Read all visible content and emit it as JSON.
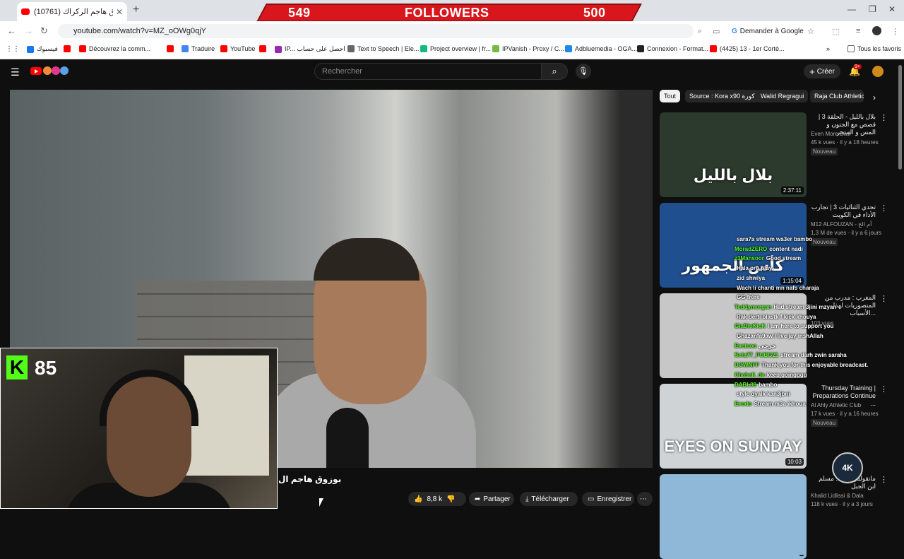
{
  "browser": {
    "tab_title": "بوزوق هاجم الركراك (10761)",
    "url": "youtube.com/watch?v=MZ_oOWg0qjY",
    "ask_google": "Demander à Google",
    "bookmarks": [
      {
        "label": "فيسبوك",
        "color": "#1877f2"
      },
      {
        "label": "",
        "color": "#ff0000"
      },
      {
        "label": "Découvrez la comm...",
        "color": "#ff0000"
      },
      {
        "label": "",
        "color": "#ff0000"
      },
      {
        "label": "Traduire",
        "color": "#4285f4"
      },
      {
        "label": "YouTube",
        "color": "#ff0000"
      },
      {
        "label": "",
        "color": "#ff0000"
      },
      {
        "label": "IP... احصل على حساب",
        "color": "#9c27b0"
      },
      {
        "label": "Text to Speech | Ele...",
        "color": "#666666"
      },
      {
        "label": "Project overview | fr...",
        "color": "#18b87a"
      },
      {
        "label": "IPVanish - Proxy / C...",
        "color": "#70bb44"
      },
      {
        "label": "Adbluemedia - OGA...",
        "color": "#1e88e5"
      },
      {
        "label": "Connexion - Format...",
        "color": "#222222"
      },
      {
        "label": "(4425) 13 - 1er Corté...",
        "color": "#ff0000"
      }
    ],
    "all_favorites": "Tous les favoris"
  },
  "overlay": {
    "left_count": "549",
    "label": "FOLLOWERS",
    "right_count": "500",
    "kick_viewers": "85",
    "quality_badge": "4K"
  },
  "youtube": {
    "search_placeholder": "Rechercher",
    "create_label": "Créer",
    "notif_count": "9+",
    "video_title": "بوزوق هاجم ال",
    "actions": {
      "like_count": "8,8 k",
      "share": "Partager",
      "download": "Télécharger",
      "save": "Enregistrer"
    },
    "chips": [
      "Tout",
      "Source : Kora x90 كورة",
      "Walid Regragui",
      "Raja Club Athletic"
    ],
    "related": [
      {
        "title": "بلال بالليل - الحلقة 3 | قصص مع الجنون و المس و السحر",
        "channel": "Even More Bilal",
        "meta": "45 k vues · il y a 18 heures",
        "badge": "Nouveau",
        "duration": "2:37:11",
        "thumb_color": "#2b3a2c"
      },
      {
        "title": "تحدي الثنائيات 3 | تجارب الأداء في الكويت",
        "channel": "M12 ALFOUZAN - أم الخ",
        "meta": "1,3 M de vues · il y a 6 jours",
        "badge": "Nouveau",
        "duration": "1:15:04",
        "thumb_color": "#1f4f8f"
      },
      {
        "title": "المغرب : مدرب من المنصوريات لهذا الأسباب...",
        "channel": "",
        "meta": "103 vues",
        "badge": "",
        "duration": "",
        "thumb_color": "#c7c7c7"
      },
      {
        "title": "Thursday Training | Preparations Continue ...",
        "channel": "Al Ahly Athletic Club",
        "meta": "17 k vues · il y a 16 heures",
        "badge": "Nouveau",
        "duration": "10:03",
        "thumb_color": "#cfd3d6"
      },
      {
        "title": "مانقولش ليك... مسلم ابن الجبل",
        "channel": "Khalid Lidlissi & Dala",
        "meta": "118 k vues · il y a 3 jours",
        "badge": "",
        "duration": "",
        "thumb_color": "#8fb8d8"
      }
    ],
    "thumb_captions": [
      "بلال بالليل",
      "كأس الجمهور",
      "",
      "EYES ON SUNDAY",
      ""
    ]
  },
  "chat": [
    {
      "user": "",
      "msg": "sara7a stream wa3er bambo"
    },
    {
      "user": "MoradZERO",
      "msg": "content nadi"
    },
    {
      "user": "z3Mansoor",
      "msg": "Good stream"
    },
    {
      "user": "",
      "msg": "Hala pro play."
    },
    {
      "user": "",
      "msg": "zid shwiya"
    },
    {
      "user": "",
      "msg": "Wach li chanti mn nafs charaja"
    },
    {
      "user": "",
      "msg": "GG frère"
    },
    {
      "user": "Teddymorgan",
      "msg": "Had stream 3jini mzyan"
    },
    {
      "user": "",
      "msg": "Rak derti blastk f kick khouya"
    },
    {
      "user": "GiaDioKicK",
      "msg": "I am here to support you"
    },
    {
      "user": "",
      "msg": "Ghazanfa9aw I live jay inshAllah"
    },
    {
      "user": "Evetcoo",
      "msg": "خرجي"
    },
    {
      "user": "Sefa77_PUBG21",
      "msg": "stream darh zwin saraha"
    },
    {
      "user": "DOWNFF",
      "msg": "Thank you for this enjoyable broadcast."
    },
    {
      "user": "Chabali_da",
      "msg": "keep goingggg"
    },
    {
      "user": "DABL99",
      "msg": "bambo"
    },
    {
      "user": "",
      "msg": "style dyalk kan3jbni"
    },
    {
      "user": "Exodo",
      "msg": "Stream m3a ikhoua"
    }
  ]
}
